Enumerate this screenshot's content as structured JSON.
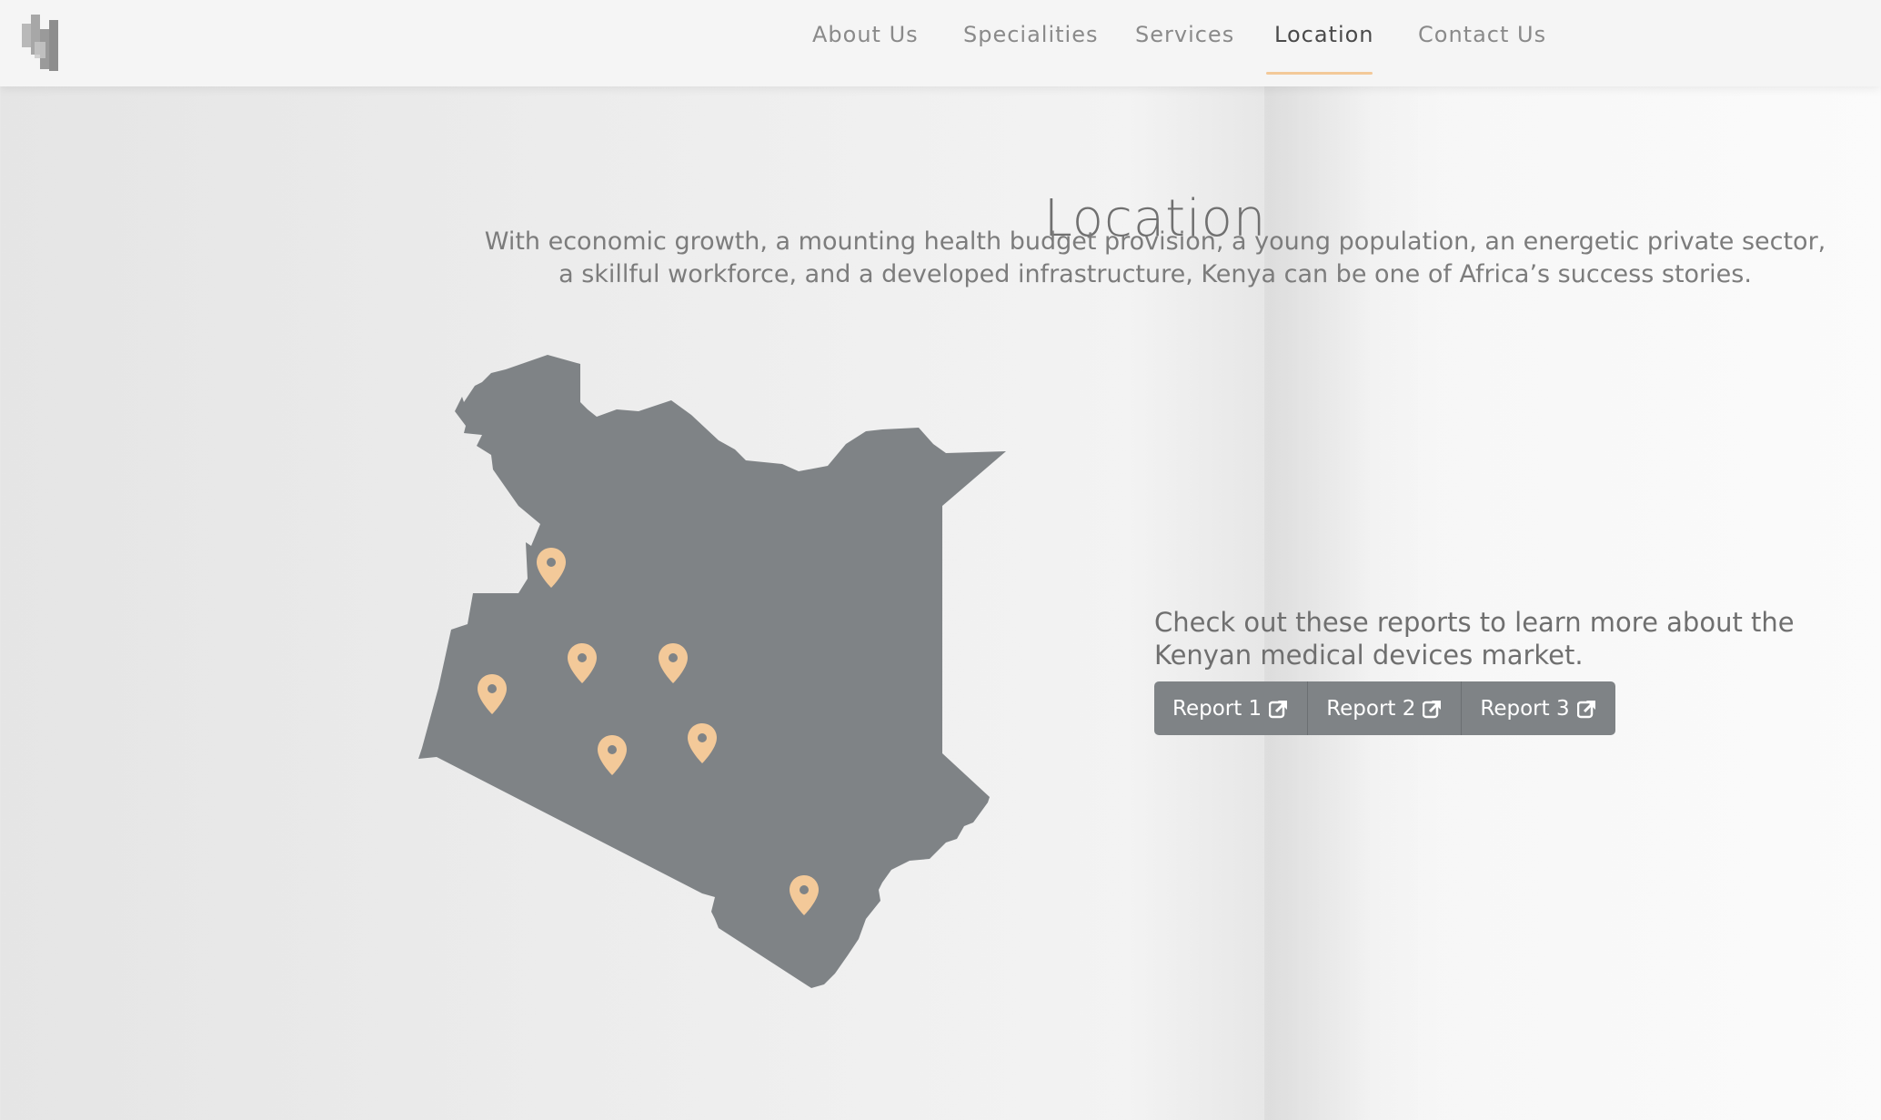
{
  "nav": {
    "items": [
      {
        "label": "About Us"
      },
      {
        "label": "Specialities"
      },
      {
        "label": "Services"
      },
      {
        "label": "Location"
      },
      {
        "label": "Contact Us"
      }
    ],
    "active": "Location"
  },
  "logo": {
    "icon": "building-logo-icon"
  },
  "page": {
    "title": "Location",
    "intro": "With economic growth, a mounting health budget provision, a young population, an energetic private sector, a skillful workforce, and a developed infrastructure, Kenya can be one of Africa’s success stories."
  },
  "map": {
    "country": "Kenya",
    "fill_color": "#7f8386",
    "pin_color": "#f3c999",
    "pin_count": 7
  },
  "reports": {
    "text": "Check out these reports to learn more about the Kenyan medical devices market.",
    "buttons": [
      {
        "label": "Report 1",
        "icon": "external-link-icon"
      },
      {
        "label": "Report 2",
        "icon": "external-link-icon"
      },
      {
        "label": "Report 3",
        "icon": "external-link-icon"
      }
    ]
  },
  "colors": {
    "accent": "#f3c999",
    "button_bg": "#7f8386"
  }
}
